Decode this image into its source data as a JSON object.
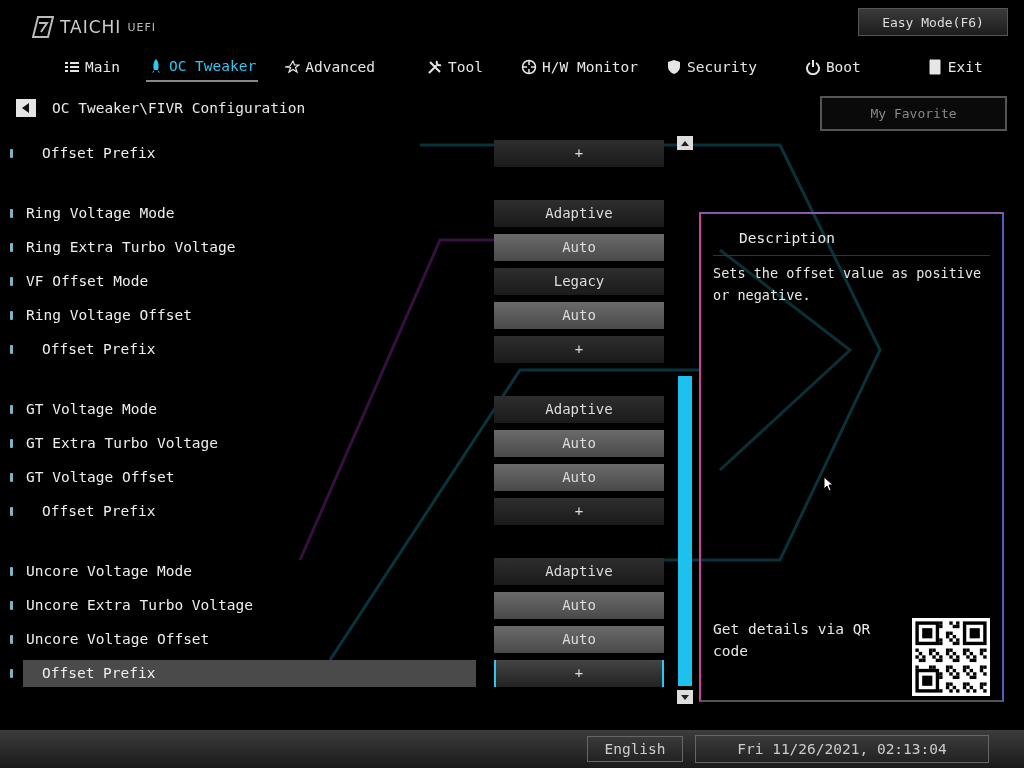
{
  "brand": {
    "name": "TAICHI",
    "suffix": "UEFI"
  },
  "mode_button": "Easy Mode(F6)",
  "tabs": [
    {
      "label": "Main",
      "selected": false
    },
    {
      "label": "OC Tweaker",
      "selected": true
    },
    {
      "label": "Advanced",
      "selected": false
    },
    {
      "label": "Tool",
      "selected": false
    },
    {
      "label": "H/W Monitor",
      "selected": false
    },
    {
      "label": "Security",
      "selected": false
    },
    {
      "label": "Boot",
      "selected": false
    },
    {
      "label": "Exit",
      "selected": false
    }
  ],
  "breadcrumb": "OC Tweaker\\FIVR Configuration",
  "favorite_button": "My Favorite",
  "settings": [
    {
      "kind": "setting",
      "label": "Offset Prefix",
      "sub": true,
      "value": {
        "kind": "option",
        "text": "+"
      },
      "selected": false
    },
    {
      "kind": "gap"
    },
    {
      "kind": "setting",
      "label": "Ring Voltage Mode",
      "sub": false,
      "value": {
        "kind": "option",
        "text": "Adaptive"
      },
      "selected": false
    },
    {
      "kind": "setting",
      "label": "Ring Extra Turbo Voltage",
      "sub": false,
      "value": {
        "kind": "field",
        "text": "Auto"
      },
      "selected": false
    },
    {
      "kind": "setting",
      "label": "VF Offset Mode",
      "sub": false,
      "value": {
        "kind": "option",
        "text": "Legacy"
      },
      "selected": false
    },
    {
      "kind": "setting",
      "label": "Ring Voltage Offset",
      "sub": false,
      "value": {
        "kind": "field",
        "text": "Auto"
      },
      "selected": false
    },
    {
      "kind": "setting",
      "label": "Offset Prefix",
      "sub": true,
      "value": {
        "kind": "option",
        "text": "+"
      },
      "selected": false
    },
    {
      "kind": "gap"
    },
    {
      "kind": "setting",
      "label": "GT Voltage Mode",
      "sub": false,
      "value": {
        "kind": "option",
        "text": "Adaptive"
      },
      "selected": false
    },
    {
      "kind": "setting",
      "label": "GT Extra Turbo Voltage",
      "sub": false,
      "value": {
        "kind": "field",
        "text": "Auto"
      },
      "selected": false
    },
    {
      "kind": "setting",
      "label": "GT Voltage Offset",
      "sub": false,
      "value": {
        "kind": "field",
        "text": "Auto"
      },
      "selected": false
    },
    {
      "kind": "setting",
      "label": "Offset Prefix",
      "sub": true,
      "value": {
        "kind": "option",
        "text": "+"
      },
      "selected": false
    },
    {
      "kind": "gap"
    },
    {
      "kind": "setting",
      "label": "Uncore Voltage Mode",
      "sub": false,
      "value": {
        "kind": "option",
        "text": "Adaptive"
      },
      "selected": false
    },
    {
      "kind": "setting",
      "label": "Uncore Extra Turbo Voltage",
      "sub": false,
      "value": {
        "kind": "field",
        "text": "Auto"
      },
      "selected": false
    },
    {
      "kind": "setting",
      "label": "Uncore Voltage Offset",
      "sub": false,
      "value": {
        "kind": "field",
        "text": "Auto"
      },
      "selected": false
    },
    {
      "kind": "setting",
      "label": "Offset Prefix",
      "sub": true,
      "value": {
        "kind": "option",
        "text": "+"
      },
      "selected": true
    }
  ],
  "description": {
    "title": "Description",
    "text": "Sets the offset value as positive or negative.",
    "qr_text": "Get details via QR code"
  },
  "status_bar": {
    "language": "English",
    "datetime": "Fri 11/26/2021, 02:13:04"
  }
}
